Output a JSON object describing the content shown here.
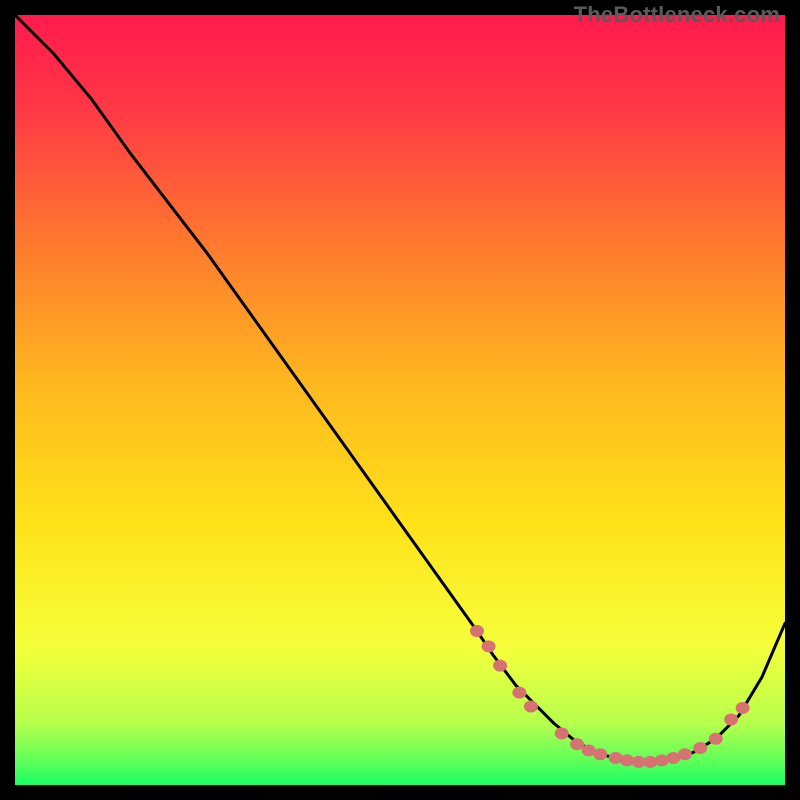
{
  "watermark": "TheBottleneck.com",
  "chart_data": {
    "type": "line",
    "title": "",
    "xlabel": "",
    "ylabel": "",
    "xlim": [
      0,
      100
    ],
    "ylim": [
      0,
      100
    ],
    "background_gradient": {
      "top_color": "#ff1a4d",
      "mid_color": "#ffe21a",
      "bottom_color": "#1aff66"
    },
    "series": [
      {
        "name": "bottleneck-curve",
        "x": [
          0,
          5,
          10,
          15,
          20,
          25,
          30,
          35,
          40,
          45,
          50,
          55,
          60,
          62,
          65,
          68,
          70,
          73,
          76,
          80,
          83,
          85,
          88,
          91,
          94,
          97,
          100
        ],
        "y": [
          100,
          95,
          89,
          82,
          75.5,
          69,
          62,
          55,
          48,
          41,
          34,
          27,
          20,
          17,
          13,
          10,
          8,
          5.5,
          4,
          3,
          3,
          3.3,
          4.2,
          6,
          9,
          14,
          21
        ],
        "color": "#000000"
      }
    ],
    "markers": {
      "name": "highlight-points",
      "color": "#d67272",
      "points": [
        {
          "x": 60,
          "y": 20
        },
        {
          "x": 61.5,
          "y": 18
        },
        {
          "x": 63,
          "y": 15.5
        },
        {
          "x": 65.5,
          "y": 12
        },
        {
          "x": 67,
          "y": 10.2
        },
        {
          "x": 71,
          "y": 6.7
        },
        {
          "x": 73,
          "y": 5.3
        },
        {
          "x": 74.5,
          "y": 4.5
        },
        {
          "x": 76,
          "y": 4
        },
        {
          "x": 78,
          "y": 3.5
        },
        {
          "x": 79.5,
          "y": 3.2
        },
        {
          "x": 81,
          "y": 3
        },
        {
          "x": 82.5,
          "y": 3
        },
        {
          "x": 84,
          "y": 3.2
        },
        {
          "x": 85.5,
          "y": 3.5
        },
        {
          "x": 87,
          "y": 4
        },
        {
          "x": 89,
          "y": 4.8
        },
        {
          "x": 91,
          "y": 6
        },
        {
          "x": 93,
          "y": 8.5
        },
        {
          "x": 94.5,
          "y": 10
        }
      ]
    }
  }
}
